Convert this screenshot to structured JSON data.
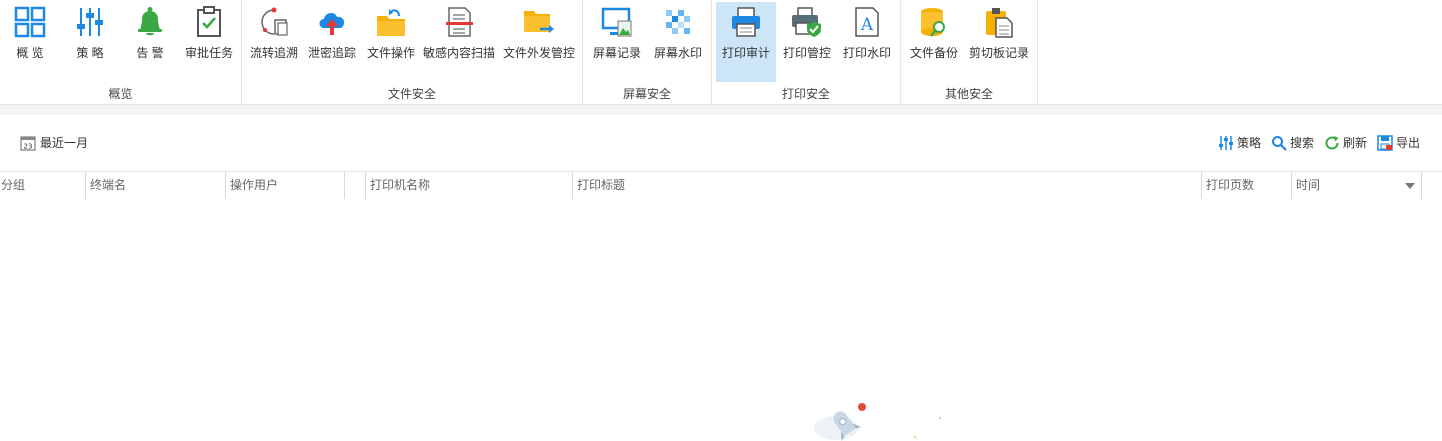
{
  "ribbon": {
    "groups": [
      {
        "label": "概览",
        "buttons": [
          {
            "label": "概 览",
            "icon": "grid-icon"
          },
          {
            "label": "策 略",
            "icon": "sliders-icon"
          },
          {
            "label": "告 警",
            "icon": "bell-icon"
          },
          {
            "label": "审批任务",
            "icon": "clipboard-check-icon"
          }
        ]
      },
      {
        "label": "文件安全",
        "buttons": [
          {
            "label": "流转追溯",
            "icon": "flow-trace-icon"
          },
          {
            "label": "泄密追踪",
            "icon": "cloud-upload-icon"
          },
          {
            "label": "文件操作",
            "icon": "folder-arrow-icon"
          },
          {
            "label": "敏感内容扫描",
            "icon": "document-scan-icon"
          },
          {
            "label": "文件外发管控",
            "icon": "folder-send-icon"
          }
        ]
      },
      {
        "label": "屏幕安全",
        "buttons": [
          {
            "label": "屏幕记录",
            "icon": "monitor-icon"
          },
          {
            "label": "屏幕水印",
            "icon": "watermark-icon"
          }
        ]
      },
      {
        "label": "打印安全",
        "buttons": [
          {
            "label": "打印审计",
            "icon": "printer-icon",
            "active": true
          },
          {
            "label": "打印管控",
            "icon": "printer-shield-icon"
          },
          {
            "label": "打印水印",
            "icon": "print-watermark-icon"
          }
        ]
      },
      {
        "label": "其他安全",
        "buttons": [
          {
            "label": "文件备份",
            "icon": "database-search-icon"
          },
          {
            "label": "剪切板记录",
            "icon": "clipboard-doc-icon"
          }
        ]
      }
    ]
  },
  "toolbar": {
    "date_range": "最近一月",
    "date_icon_day": "23",
    "strategy": "策略",
    "search": "搜索",
    "refresh": "刷新",
    "export": "导出"
  },
  "table": {
    "columns": [
      "分组",
      "终端名",
      "操作用户",
      "",
      "打印机名称",
      "打印标题",
      "打印页数",
      "时间"
    ]
  },
  "colors": {
    "accent": "#1e88e5",
    "active_bg": "#cde6f7",
    "folder": "#f6b100",
    "alert": "#3aa845"
  }
}
